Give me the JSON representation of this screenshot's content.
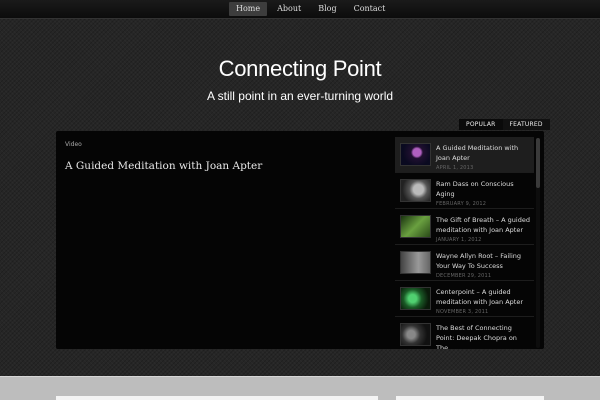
{
  "nav": {
    "items": [
      {
        "label": "Home",
        "active": true
      },
      {
        "label": "About",
        "active": false
      },
      {
        "label": "Blog",
        "active": false
      },
      {
        "label": "Contact",
        "active": false
      }
    ]
  },
  "site": {
    "title": "Connecting Point",
    "tagline": "A still point in an ever-turning world"
  },
  "tabs": {
    "popular": "POPULAR",
    "featured": "FEATURED"
  },
  "video": {
    "label": "Video",
    "title": "A Guided Meditation with Joan Apter"
  },
  "sidebar": {
    "items": [
      {
        "title": "A Guided Meditation with Joan Apter",
        "date": "APRIL 1, 2013",
        "thumb_color": "#1a1a3a"
      },
      {
        "title": "Ram Dass on Conscious Aging",
        "date": "FEBRUARY 9, 2012",
        "thumb_color": "#5a5a5a"
      },
      {
        "title": "The Gift of Breath – A guided meditation with Joan Apter",
        "date": "JANUARY 1, 2012",
        "thumb_color": "#3e6a2a"
      },
      {
        "title": "Wayne Allyn Root – Failing Your Way To Success",
        "date": "DECEMBER 29, 2011",
        "thumb_color": "#777777"
      },
      {
        "title": "Centerpoint – A guided meditation with Joan Apter",
        "date": "NOVEMBER 3, 2011",
        "thumb_color": "#1f6b2c"
      },
      {
        "title": "The Best of Connecting Point: Deepak Chopra on The",
        "date": "",
        "thumb_color": "#333333"
      }
    ]
  }
}
